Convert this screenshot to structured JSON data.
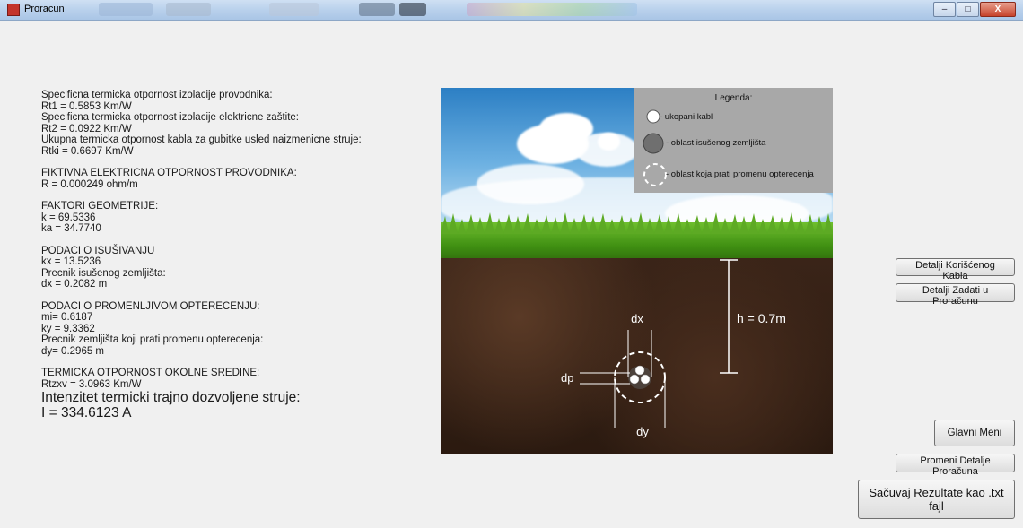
{
  "window": {
    "title": "Proracun",
    "buttons": {
      "minimize": "–",
      "maximize": "□",
      "close": "X"
    }
  },
  "results": [
    "Specificna termicka otpornost izolacije provodnika:",
    "Rt1 = 0.5853 Km/W",
    "Specificna termicka otpornost izolacije elektricne zaštite:",
    "Rt2 = 0.0922 Km/W",
    "Ukupna termicka otpornost kabla za gubitke usled naizmenicne struje:",
    "Rtki = 0.6697 Km/W",
    "",
    "FIKTIVNA ELEKTRICNA OTPORNOST PROVODNIKA:",
    "R = 0.000249 ohm/m",
    "",
    "FAKTORI GEOMETRIJE:",
    "k = 69.5336",
    "ka = 34.7740",
    "",
    "PODACI O ISUŠIVANJU",
    "kx = 13.5236",
    "Precnik isušenog zemljišta:",
    "dx = 0.2082 m",
    "",
    "PODACI O PROMENLJIVOM OPTERECENJU:",
    "mi= 0.6187",
    "ky = 9.3362",
    "Precnik zemljišta koji prati promenu opterecenja:",
    "dy= 0.2965 m",
    "",
    "TERMICKA OTPORNOST OKOLNE SREDINE:",
    "Rtzxv = 3.0963 Km/W"
  ],
  "result_big": [
    "Intenzitet termicki trajno dozvoljene struje:",
    "I = 334.6123 A"
  ],
  "legend": {
    "title": "Legenda:",
    "items": [
      "- ukopani kabl",
      "- oblast isušenog zemljišta",
      "- oblast koja prati promenu opterecenja"
    ]
  },
  "diagram": {
    "dx_label": "dx",
    "dp_label": "dp",
    "dy_label": "dy",
    "h_label": "h = 0.7m"
  },
  "buttons": {
    "cable_details": "Detalji Korišćenog Kabla",
    "calc_details": "Detalji Zadati u Proračunu",
    "main_menu": "Glavni Meni",
    "change_details": "Promeni Detalje Proračuna",
    "save_txt": "Sačuvaj Rezultate kao .txt fajl"
  },
  "colors": {
    "legend_bg": "#a8a8a8",
    "window_bg": "#f0f0f0",
    "soil": "#3a2418",
    "grass": "#3f8f12",
    "sky": "#2c7fc4"
  }
}
